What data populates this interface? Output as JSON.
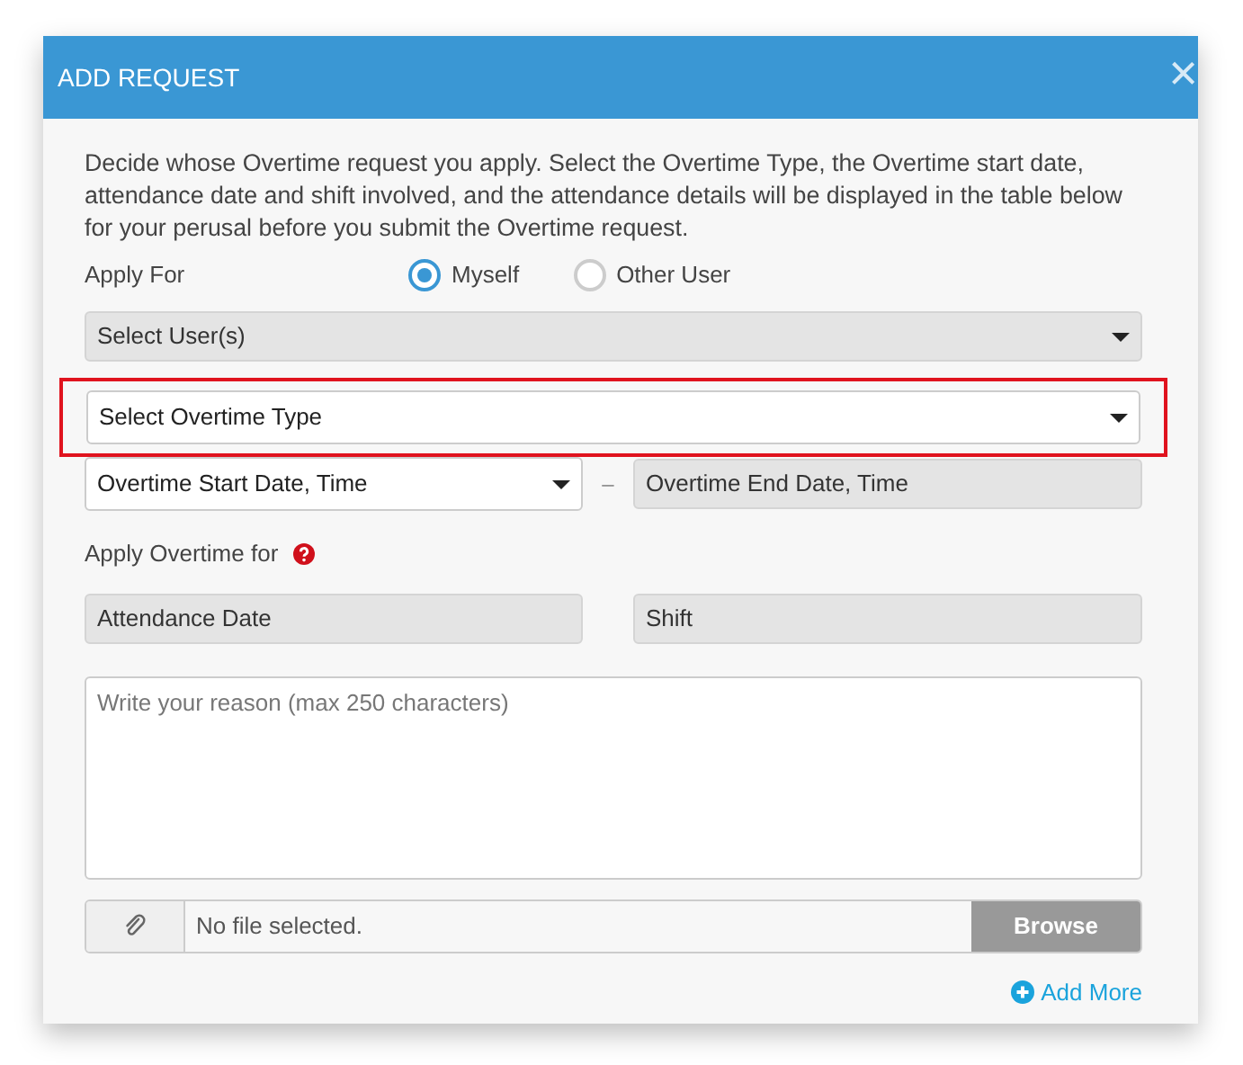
{
  "dialog": {
    "title": "ADD REQUEST",
    "close": "×"
  },
  "intro": "Decide whose Overtime request you apply. Select the Overtime Type, the Overtime start date, attendance date and shift involved, and the attendance details will be displayed in the table below for your perusal before you submit the Overtime request.",
  "apply_for": {
    "label": "Apply For",
    "options": [
      {
        "label": "Myself",
        "selected": true
      },
      {
        "label": "Other User",
        "selected": false
      }
    ]
  },
  "user_select": {
    "placeholder": "Select User(s)",
    "disabled": true
  },
  "overtime_type": {
    "placeholder": "Select Overtime Type",
    "disabled": false,
    "highlighted": true
  },
  "start": {
    "placeholder": "Overtime Start Date, Time",
    "disabled": false
  },
  "separator": "–",
  "end": {
    "placeholder": "Overtime End Date, Time",
    "disabled": true
  },
  "apply_overtime_for": {
    "label": "Apply Overtime for"
  },
  "attendance_date": {
    "placeholder": "Attendance Date",
    "disabled": true
  },
  "shift": {
    "placeholder": "Shift",
    "disabled": true
  },
  "reason": {
    "placeholder": "Write your reason (max 250 characters)"
  },
  "file": {
    "status": "No file selected.",
    "button": "Browse"
  },
  "add_more": "Add More"
}
